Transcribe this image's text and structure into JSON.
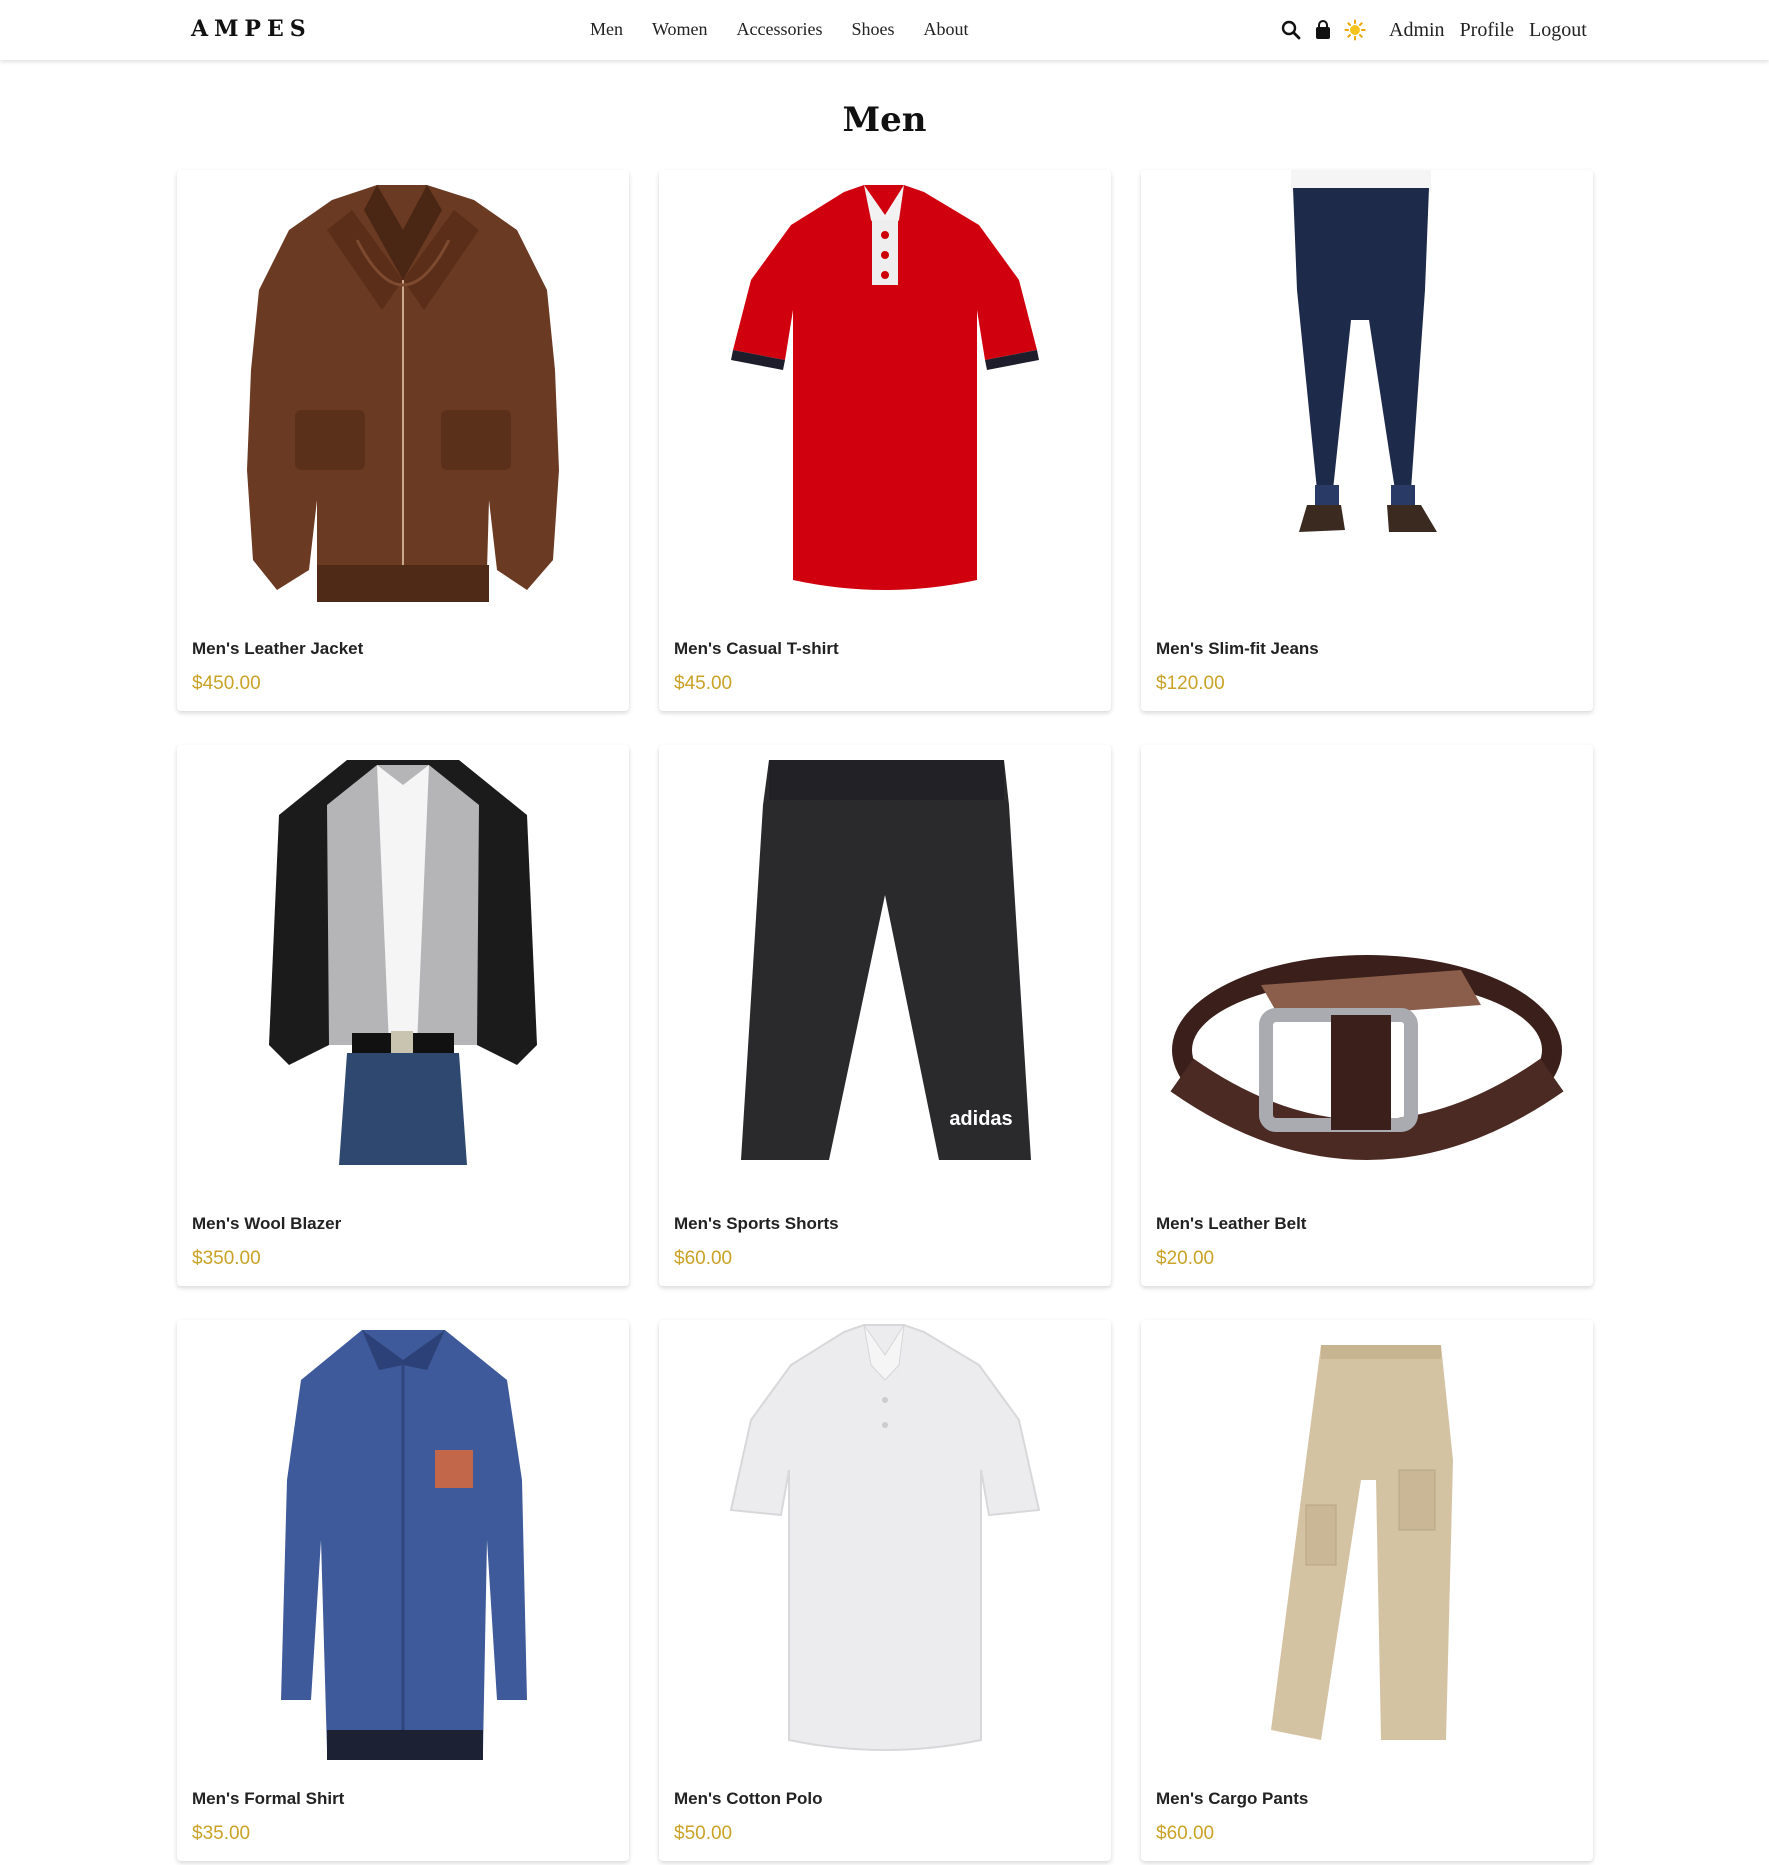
{
  "header": {
    "brand": "AMPES",
    "nav": [
      "Men",
      "Women",
      "Accessories",
      "Shoes",
      "About"
    ],
    "icons": [
      "search-icon",
      "shopping-bag-icon",
      "sun-icon"
    ],
    "links": [
      "Admin",
      "Profile",
      "Logout"
    ]
  },
  "page": {
    "title": "Men"
  },
  "colors": {
    "price": "#c9a227",
    "text": "#222222"
  },
  "products": [
    {
      "name": "Men's Leather Jacket",
      "price": "$450.00",
      "image": "leather-jacket"
    },
    {
      "name": "Men's Casual T-shirt",
      "price": "$45.00",
      "image": "red-polo"
    },
    {
      "name": "Men's Slim-fit Jeans",
      "price": "$120.00",
      "image": "jeans"
    },
    {
      "name": "Men's Wool Blazer",
      "price": "$350.00",
      "image": "blazer"
    },
    {
      "name": "Men's Sports Shorts",
      "price": "$60.00",
      "image": "shorts"
    },
    {
      "name": "Men's Leather Belt",
      "price": "$20.00",
      "image": "belt"
    },
    {
      "name": "Men's Formal Shirt",
      "price": "$35.00",
      "image": "shirt"
    },
    {
      "name": "Men's Cotton Polo",
      "price": "$50.00",
      "image": "white-polo"
    },
    {
      "name": "Men's Cargo Pants",
      "price": "$60.00",
      "image": "cargo-pants"
    }
  ]
}
